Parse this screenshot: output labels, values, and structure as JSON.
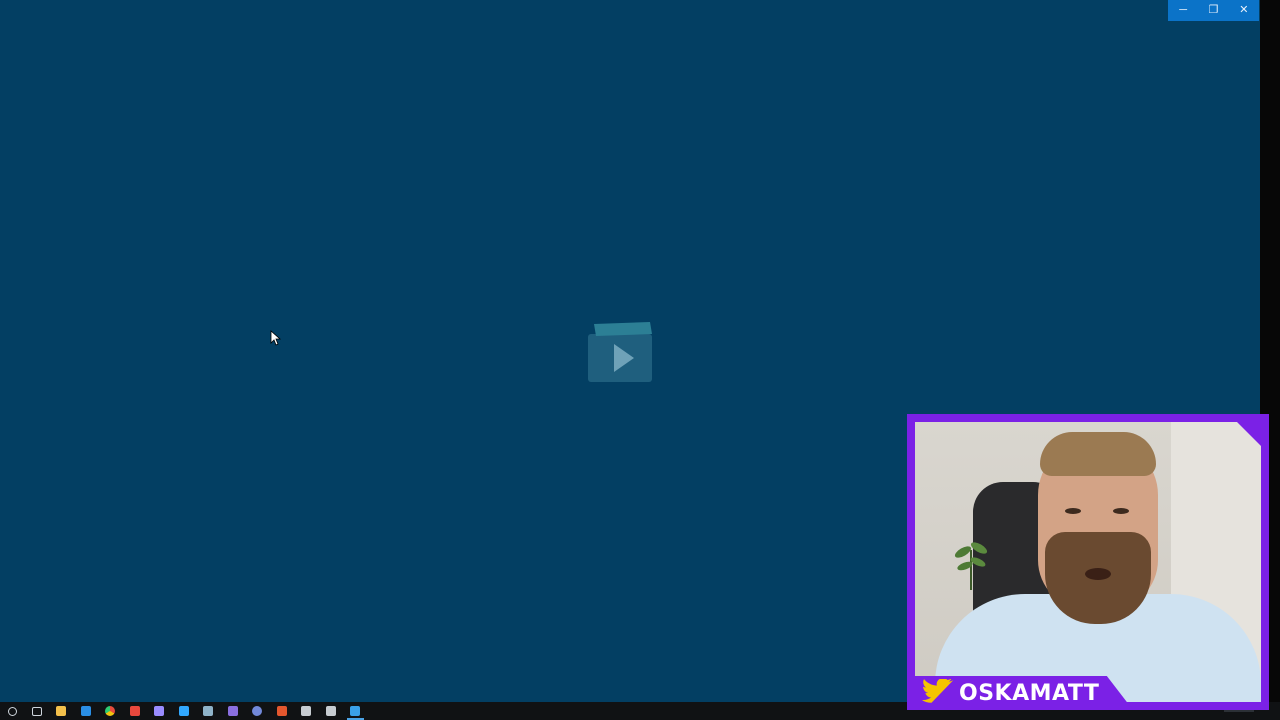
{
  "window": {
    "controls": {
      "minimize_glyph": "─",
      "restore_glyph": "❐",
      "close_glyph": "✕"
    },
    "background_color": "#033f63",
    "controls_color": "#0b73c8"
  },
  "splash": {
    "icon": "video-clapper-play-icon"
  },
  "taskbar": {
    "icons": [
      {
        "name": "search-icon",
        "color": "#cfd6dd"
      },
      {
        "name": "task-view-icon",
        "color": "#cfd6dd"
      },
      {
        "name": "file-explorer-icon",
        "color": "#f3c04b"
      },
      {
        "name": "mail-icon",
        "color": "#2a8fe6"
      },
      {
        "name": "chrome-icon",
        "color": "#e9b23a"
      },
      {
        "name": "app-red-icon",
        "color": "#e8483d"
      },
      {
        "name": "premiere-icon",
        "color": "#9a8cff"
      },
      {
        "name": "photoshop-icon",
        "color": "#31a8ff"
      },
      {
        "name": "illustrator-icon",
        "color": "#8fb3c9"
      },
      {
        "name": "app-purple-icon",
        "color": "#8a6fe0"
      },
      {
        "name": "discord-icon",
        "color": "#7289da"
      },
      {
        "name": "app-orange-icon",
        "color": "#e4572e"
      },
      {
        "name": "settings-icon",
        "color": "#c7ccd1"
      },
      {
        "name": "monitor-icon",
        "color": "#c7ccd1"
      },
      {
        "name": "video-editor-icon",
        "color": "#3aa0e8",
        "active": true
      }
    ]
  },
  "webcam": {
    "handle": "OSKAMATT",
    "frame_color": "#7b21e6",
    "banner_icon": "twitter-bird-icon",
    "banner_icon_color": "#f5c400"
  }
}
